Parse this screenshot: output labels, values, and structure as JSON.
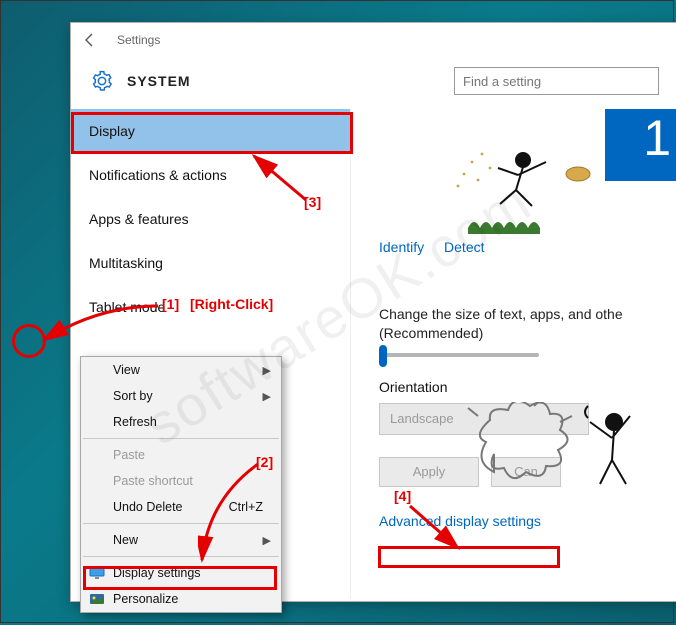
{
  "titlebar": {
    "title": "Settings"
  },
  "header": {
    "label": "SYSTEM",
    "search_placeholder": "Find a setting"
  },
  "sidebar": {
    "items": [
      {
        "label": "Display",
        "selected": true
      },
      {
        "label": "Notifications & actions",
        "selected": false
      },
      {
        "label": "Apps & features",
        "selected": false
      },
      {
        "label": "Multitasking",
        "selected": false
      },
      {
        "label": "Tablet mode",
        "selected": false
      }
    ]
  },
  "main": {
    "monitor_number": "1",
    "identify_label": "Identify",
    "detect_label": "Detect",
    "size_text_line1": "Change the size of text, apps, and othe",
    "size_text_line2": "(Recommended)",
    "orientation_label": "Orientation",
    "orientation_value": "Landscape",
    "apply_label": "Apply",
    "cancel_label": "Can",
    "advanced_link": "Advanced display settings"
  },
  "context_menu": {
    "items": [
      {
        "label": "View",
        "submenu": true
      },
      {
        "label": "Sort by",
        "submenu": true
      },
      {
        "label": "Refresh"
      },
      {
        "sep": true
      },
      {
        "label": "Paste",
        "disabled": true
      },
      {
        "label": "Paste shortcut",
        "disabled": true
      },
      {
        "label": "Undo Delete",
        "shortcut": "Ctrl+Z"
      },
      {
        "sep": true
      },
      {
        "label": "New",
        "submenu": true
      },
      {
        "sep": true
      },
      {
        "label": "Display settings",
        "icon": "monitor"
      },
      {
        "label": "Personalize",
        "icon": "personalize"
      }
    ]
  },
  "annotations": {
    "a1": "[1]",
    "a1b": "[Right-Click]",
    "a2": "[2]",
    "a3": "[3]",
    "a4": "[4]"
  },
  "watermark": "softwareOK.com"
}
